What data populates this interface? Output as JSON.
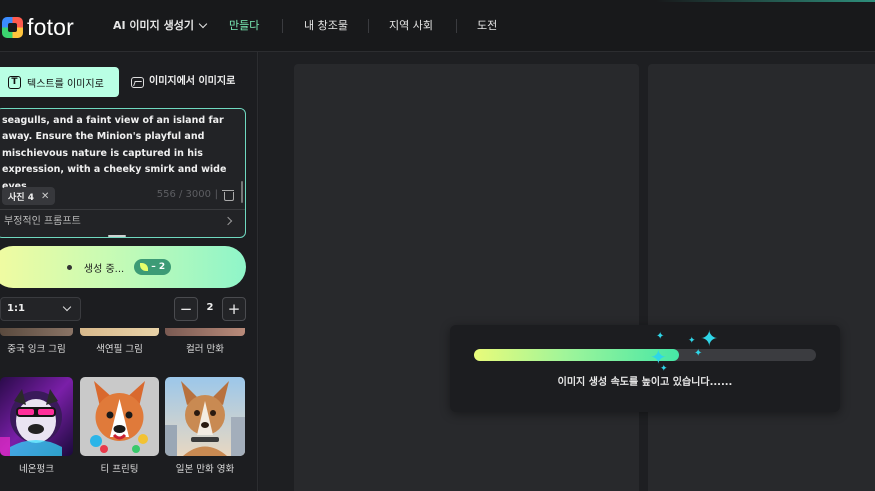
{
  "app": {
    "logo_text": "fotor",
    "nav": {
      "ai_menu": "AI 이미지 생성기",
      "create": "만들다",
      "my_creations": "내 창조물",
      "community": "지역 사회",
      "challenge": "도전"
    }
  },
  "sidebar": {
    "tabs": {
      "text_to_image": "텍스트를 이미지로",
      "image_to_image": "이미지에서 이미지로"
    },
    "prompt": {
      "text": "seagulls, and a faint view of an island far away. Ensure the Minion's playful and mischievous nature is captured in his expression, with a cheeky smirk and wide eyes.",
      "chip_label": "사진 4",
      "char_count": "556 / 3000",
      "count_sep": "|",
      "negative_prompt_label": "부정적인 프롬프트"
    },
    "generate_button": {
      "label": "생성 중...",
      "credit": "– 2"
    },
    "ratio_select": {
      "value": "1:1"
    },
    "quantity": {
      "minus": "−",
      "value": "2",
      "plus": "+"
    },
    "styles": [
      {
        "label": "중국 잉크 그림"
      },
      {
        "label": "색연필 그림"
      },
      {
        "label": "컬러 만화"
      },
      {
        "label": "네온펑크"
      },
      {
        "label": "티 프린팅"
      },
      {
        "label": "일본 만화 영화"
      }
    ]
  },
  "canvas": {
    "progress": {
      "fraction": 0.6,
      "message": "이미지 생성 속도를 높이고 있습니다......"
    }
  },
  "colors": {
    "accent": "#7cf0b8",
    "tab_active": "#b9ffe4",
    "prompt_border": "#6fd9c0",
    "sparkle": "#2fd6e8"
  }
}
